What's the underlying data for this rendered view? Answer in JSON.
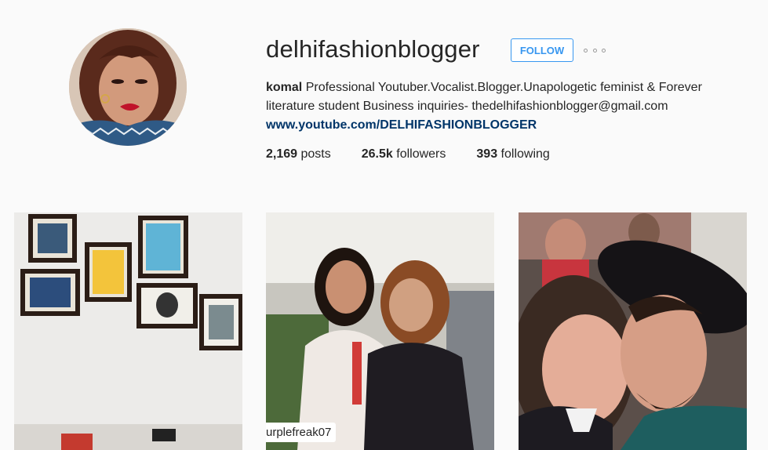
{
  "profile": {
    "username": "delhifashionblogger",
    "follow_label": "FOLLOW",
    "more_label": "More options",
    "full_name": "komal",
    "bio_text": "Professional Youtuber.Vocalist.Blogger.Unapologetic feminist & Forever literature student Business inquiries- thedelhifashionblogger@gmail.com",
    "website": "www.youtube.com/DELHIFASHIONBLOGGER"
  },
  "stats": {
    "posts_count": "2,169",
    "posts_label": "posts",
    "followers_count": "26.5k",
    "followers_label": "followers",
    "following_count": "393",
    "following_label": "following"
  },
  "posts": [
    {
      "description": "",
      "caption": ""
    },
    {
      "description": "",
      "caption": "urplefreak07"
    },
    {
      "description": "",
      "caption": ""
    }
  ],
  "colors": {
    "accent": "#3897f0",
    "link": "#003569",
    "background": "#fafafa"
  }
}
